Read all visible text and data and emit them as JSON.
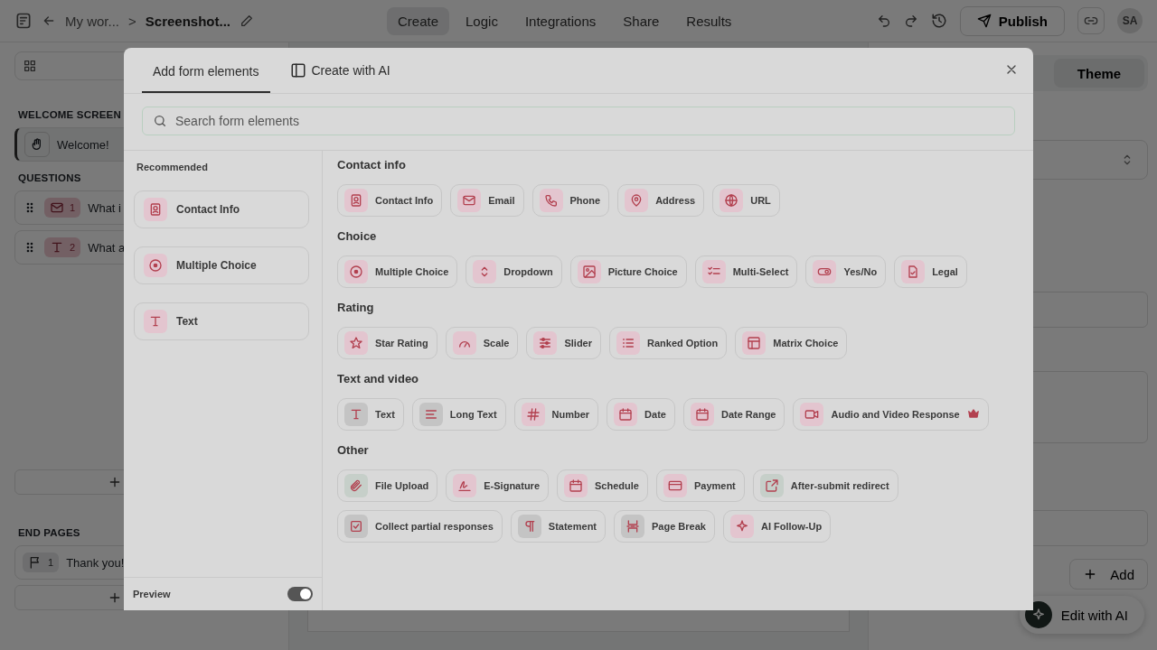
{
  "topbar": {
    "breadcrumb": "My wor...",
    "separator": ">",
    "title": "Screenshot...",
    "tabs": [
      {
        "label": "Create",
        "selected": true
      },
      {
        "label": "Logic",
        "selected": false
      },
      {
        "label": "Integrations",
        "selected": false
      },
      {
        "label": "Share",
        "selected": false
      },
      {
        "label": "Results",
        "selected": false
      }
    ],
    "publish": "Publish",
    "avatar": "SA"
  },
  "sidebar": {
    "welcome_header": "WELCOME SCREEN",
    "welcome_item": {
      "label": "Welcome!",
      "selected": true
    },
    "questions_header": "QUESTIONS",
    "questions": [
      {
        "number": "1",
        "label": "What i"
      },
      {
        "number": "2",
        "label": "What a"
      }
    ],
    "end_header": "END PAGES",
    "end_pages": [
      {
        "number": "1",
        "label": "Thank you!"
      }
    ]
  },
  "properties": {
    "tab": "Theme",
    "add_button": "Add"
  },
  "edit_ai": "Edit with AI",
  "modal": {
    "tabs": [
      {
        "label": "Add form elements",
        "selected": true
      },
      {
        "label": "Create with AI",
        "selected": false
      }
    ],
    "search": {
      "placeholder": "Search form elements"
    },
    "recommended": {
      "title": "Recommended",
      "items": [
        {
          "label": "Contact Info"
        },
        {
          "label": "Multiple Choice"
        },
        {
          "label": "Text"
        }
      ]
    },
    "preview": {
      "label": "Preview",
      "on": true
    },
    "sections": [
      {
        "title": "Contact info",
        "items": [
          {
            "label": "Contact Info",
            "color": "#e3c5cf"
          },
          {
            "label": "Email",
            "color": "#e3c5cf"
          },
          {
            "label": "Phone",
            "color": "#e3c5cf"
          },
          {
            "label": "Address",
            "color": "#e3c5cf"
          },
          {
            "label": "URL",
            "color": "#e3c5cf"
          }
        ]
      },
      {
        "title": "Choice",
        "items": [
          {
            "label": "Multiple Choice",
            "color": "#e3c5cf"
          },
          {
            "label": "Dropdown",
            "color": "#e3c5cf"
          },
          {
            "label": "Picture Choice",
            "color": "#e3c5cf"
          },
          {
            "label": "Multi-Select",
            "color": "#e3c5cf"
          },
          {
            "label": "Yes/No",
            "color": "#e3c5cf"
          },
          {
            "label": "Legal",
            "color": "#e3c5cf"
          }
        ]
      },
      {
        "title": "Rating",
        "items": [
          {
            "label": "Star Rating",
            "color": "#e3c5cf"
          },
          {
            "label": "Scale",
            "color": "#e3c5cf"
          },
          {
            "label": "Slider",
            "color": "#e3c5cf"
          },
          {
            "label": "Ranked Option",
            "color": "#e3c5cf"
          },
          {
            "label": "Matrix Choice",
            "color": "#e3c5cf"
          }
        ]
      },
      {
        "title": "Text and video",
        "items": [
          {
            "label": "Text",
            "color": "#c4c4c4"
          },
          {
            "label": "Long Text",
            "color": "#c4c4c4"
          },
          {
            "label": "Number",
            "color": "#e3c5cf"
          },
          {
            "label": "Date",
            "color": "#e3c5cf"
          },
          {
            "label": "Date Range",
            "color": "#e3c5cf"
          },
          {
            "label": "Audio and Video Response",
            "color": "#e3c5cf",
            "premium": true
          }
        ]
      },
      {
        "title": "Other",
        "items": [
          {
            "label": "File Upload",
            "color": "#c6cfc9"
          },
          {
            "label": "E-Signature",
            "color": "#e3c5cf"
          },
          {
            "label": "Schedule",
            "color": "#e3c5cf"
          },
          {
            "label": "Payment",
            "color": "#e3c5cf"
          },
          {
            "label": "After-submit redirect",
            "color": "#c6cfc9"
          },
          {
            "label": "Collect partial responses",
            "color": "#c4c4c4"
          },
          {
            "label": "Statement",
            "color": "#c4c4c4"
          },
          {
            "label": "Page Break",
            "color": "#c4c4c4"
          },
          {
            "label": "AI Follow-Up",
            "color": "#e3c5cf"
          }
        ]
      }
    ]
  }
}
